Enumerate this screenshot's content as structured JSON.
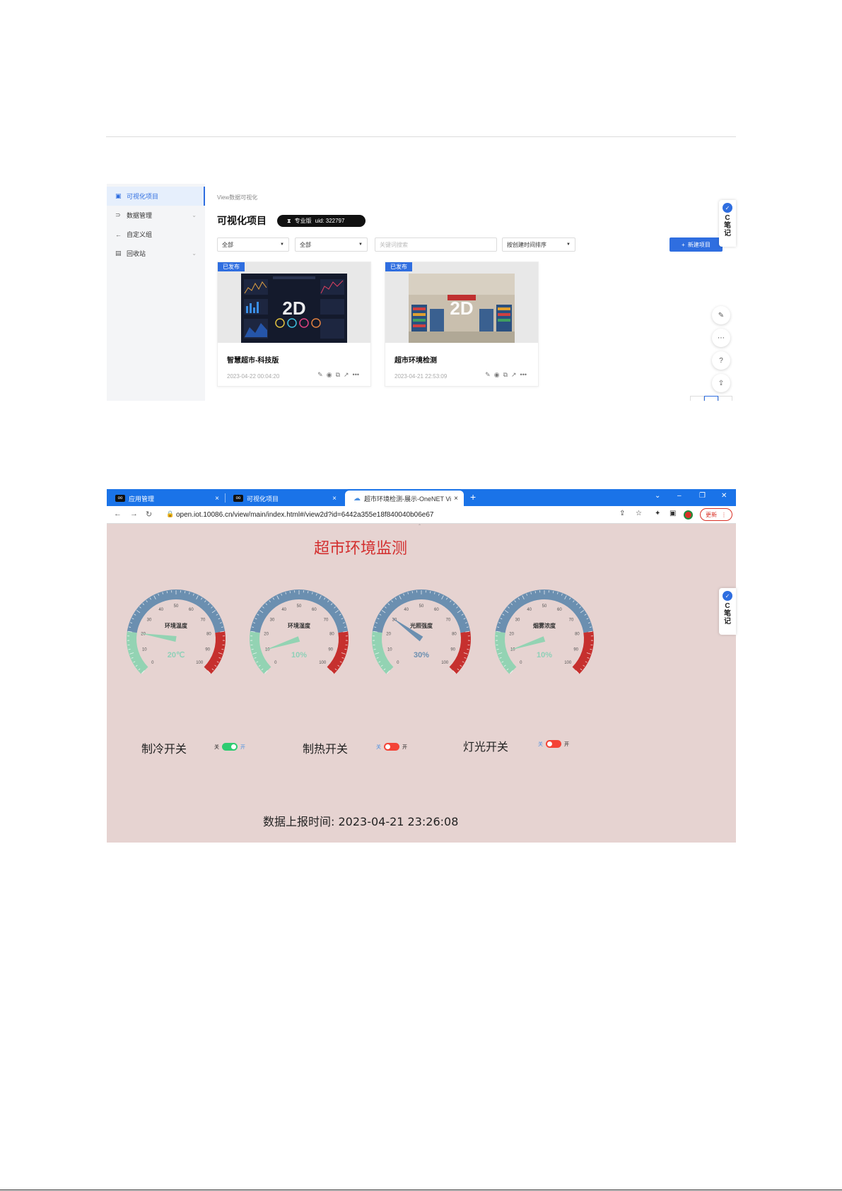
{
  "console": {
    "sidebar": {
      "items": [
        {
          "label": "可视化项目",
          "icon": "project-icon",
          "glyph": "▣",
          "active": true
        },
        {
          "label": "数据管理",
          "icon": "data-icon",
          "glyph": "⊃",
          "active": false,
          "chevron": "⌄"
        },
        {
          "label": "自定义组",
          "icon": "custom-group-icon",
          "glyph": "←",
          "active": false
        },
        {
          "label": "回收站",
          "icon": "recycle-bin-icon",
          "glyph": "▤",
          "active": false,
          "chevron": "⌄"
        }
      ]
    },
    "breadcrumb": "View数据可视化",
    "page_title": "可视化项目",
    "badge": {
      "edition": "专业版",
      "uid": "uid: 322797"
    },
    "filters": {
      "filter1": "全部",
      "filter2": "全部",
      "search_placeholder": "关键词搜索",
      "sort": "按创建时间排序"
    },
    "new_button": "新建项目",
    "cards": [
      {
        "badge": "已发布",
        "name": "智慧超市-科技版",
        "date": "2023-04-22 00:04:20",
        "overlay": "2D"
      },
      {
        "badge": "已发布",
        "name": "超市环境检测",
        "date": "2023-04-21 22:53:09",
        "overlay": "2D"
      }
    ],
    "card_ops": [
      "✎",
      "◉",
      "⧉",
      "↗",
      "•••"
    ],
    "floating": [
      "✎",
      "⋯",
      "?",
      "⇪"
    ]
  },
  "note_widget": {
    "c": "C",
    "l1": "笔",
    "l2": "记"
  },
  "browser": {
    "tabs": [
      {
        "label": "应用管理",
        "close": "×"
      },
      {
        "label": "可视化项目",
        "close": "×"
      },
      {
        "label": "超市环境检测-展示-OneNET Vi",
        "close": "×"
      }
    ],
    "new_tab": "+",
    "url": "open.iot.10086.cn/view/main/index.html#/view2d?id=6442a355e18f840040b06e67",
    "update_button": "更新",
    "window_controls": [
      "⌄",
      "–",
      "❐",
      "✕"
    ]
  },
  "dashboard": {
    "title": "超市环境监测",
    "gauges": [
      {
        "label": "环境温度",
        "value": 20,
        "display": "20℃"
      },
      {
        "label": "环境湿度",
        "value": 10,
        "display": "10%"
      },
      {
        "label": "光照强度",
        "value": 30,
        "display": "30%"
      },
      {
        "label": "烟雾浓度",
        "value": 10,
        "display": "10%"
      }
    ],
    "gauge_ticks": [
      "0",
      "10",
      "20",
      "30",
      "40",
      "50",
      "60",
      "70",
      "80",
      "90",
      "100"
    ],
    "colors": {
      "low": "#93d3b3",
      "mid": "#6b8fb0",
      "high": "#c6302e",
      "value_text": "#8fd0b8",
      "value_text_alt": "#6b8fb0"
    },
    "switches": [
      {
        "label": "制冷开关",
        "off": "关",
        "on": "开",
        "state": "on",
        "color": "#2ecc71"
      },
      {
        "label": "制热开关",
        "off": "关",
        "on": "开",
        "state": "off",
        "color": "#f44336"
      },
      {
        "label": "灯光开关",
        "off": "关",
        "on": "开",
        "state": "off",
        "color": "#f44336"
      }
    ],
    "report_label": "数据上报时间: 2023-04-21 23:26:08"
  }
}
